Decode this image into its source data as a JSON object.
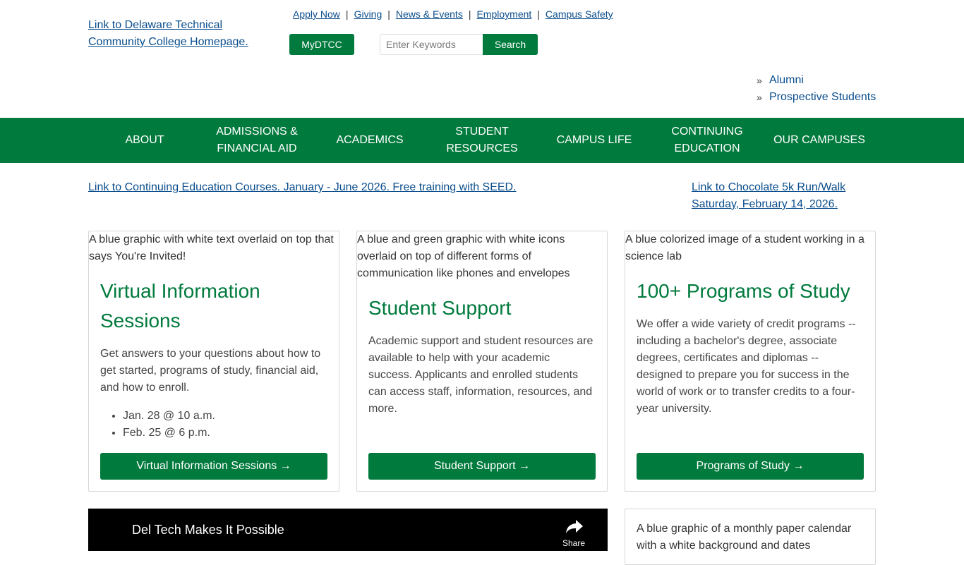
{
  "header": {
    "logo_alt": "Link to Delaware Technical Community College Homepage.",
    "utility_links": [
      "Apply Now",
      "Giving",
      "News & Events",
      "Employment",
      "Campus Safety"
    ],
    "mydtcc_label": "MyDTCC",
    "search_placeholder": "Enter Keywords",
    "search_button": "Search",
    "quick_links": [
      "Alumni",
      "Prospective Students"
    ],
    "quick_link_marker": "»"
  },
  "nav": {
    "items": [
      "About",
      "Admissions & Financial Aid",
      "Academics",
      "Student Resources",
      "Campus Life",
      "Continuing Education",
      "Our Campuses"
    ]
  },
  "banners": {
    "left_alt": "Link to Continuing Education Courses. January - June 2026. Free training with SEED.",
    "right_alt": "Link to Chocolate 5k Run/Walk Saturday, February 14, 2026."
  },
  "cards": [
    {
      "image_alt": "A blue graphic with white text overlaid on top that says You're Invited!",
      "title": "Virtual Information Sessions",
      "text": "Get answers to your questions about how to get started, programs of study, financial aid, and how to enroll.",
      "bullets": [
        "Jan. 28 @ 10 a.m.",
        "Feb. 25 @ 6 p.m."
      ],
      "cta": "Virtual Information Sessions →"
    },
    {
      "image_alt": "A blue and green graphic with white icons overlaid on top of different forms of communication like phones and envelopes",
      "title": "Student Support",
      "text": "Academic support and student resources are available to help with your academic success. Applicants and enrolled students can access staff, information, resources, and more.",
      "cta": "Student Support →"
    },
    {
      "image_alt": "A blue colorized image of a student working in a science lab",
      "title": "100+ Programs of Study",
      "text": "We offer a wide variety of credit programs -- including a bachelor's degree, associate degrees, certificates and diplomas -- designed to prepare you for success in the world of work or to transfer credits to a four-year university.",
      "cta": "Programs of Study →"
    }
  ],
  "video": {
    "title": "Del Tech Makes It Possible",
    "share_label": "Share"
  },
  "bottom_card": {
    "image_alt": "A blue graphic of a monthly paper calendar with a white background and dates"
  },
  "colors": {
    "brand_green": "#007a3d",
    "link_blue": "#0a4d8c"
  }
}
